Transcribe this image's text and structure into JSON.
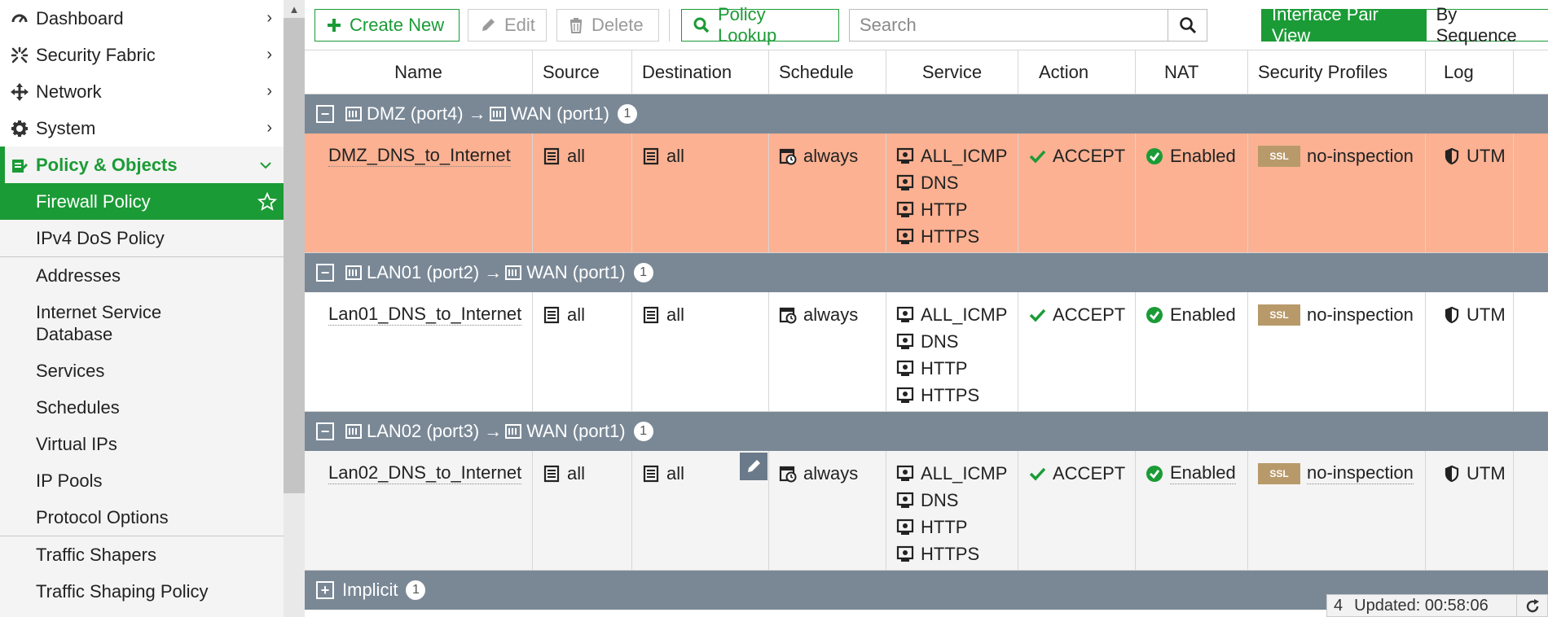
{
  "sidebar": {
    "items": [
      {
        "label": "Dashboard",
        "icon": "dashboard-icon"
      },
      {
        "label": "Security Fabric",
        "icon": "security-fabric-icon"
      },
      {
        "label": "Network",
        "icon": "network-icon"
      },
      {
        "label": "System",
        "icon": "gear-icon"
      },
      {
        "label": "Policy & Objects",
        "icon": "policy-icon"
      }
    ],
    "sub_items": [
      {
        "label": "Firewall Policy"
      },
      {
        "label": "IPv4 DoS Policy"
      },
      {
        "label": "Addresses"
      },
      {
        "label": "Internet Service Database"
      },
      {
        "label": "Services"
      },
      {
        "label": "Schedules"
      },
      {
        "label": "Virtual IPs"
      },
      {
        "label": "IP Pools"
      },
      {
        "label": "Protocol Options"
      },
      {
        "label": "Traffic Shapers"
      },
      {
        "label": "Traffic Shaping Policy"
      }
    ]
  },
  "toolbar": {
    "create_label": "Create New",
    "edit_label": "Edit",
    "delete_label": "Delete",
    "lookup_label": "Policy Lookup",
    "search_placeholder": "Search",
    "view_interface_pair": "Interface Pair View",
    "view_by_sequence": "By Sequence"
  },
  "table": {
    "columns": [
      "Name",
      "Source",
      "Destination",
      "Schedule",
      "Service",
      "Action",
      "NAT",
      "Security Profiles",
      "Log"
    ],
    "groups": [
      {
        "src_iface": "DMZ (port4)",
        "dst_iface": "WAN (port1)",
        "arrow": "→",
        "count": "1",
        "policy": {
          "name": "DMZ_DNS_to_Internet",
          "source": "all",
          "destination": "all",
          "schedule": "always",
          "services": [
            "ALL_ICMP",
            "DNS",
            "HTTP",
            "HTTPS"
          ],
          "action": "ACCEPT",
          "nat": "Enabled",
          "ssl_badge": "SSL",
          "profile": "no-inspection",
          "log": "UTM"
        }
      },
      {
        "src_iface": "LAN01 (port2)",
        "dst_iface": "WAN (port1)",
        "arrow": "→",
        "count": "1",
        "policy": {
          "name": "Lan01_DNS_to_Internet",
          "source": "all",
          "destination": "all",
          "schedule": "always",
          "services": [
            "ALL_ICMP",
            "DNS",
            "HTTP",
            "HTTPS"
          ],
          "action": "ACCEPT",
          "nat": "Enabled",
          "ssl_badge": "SSL",
          "profile": "no-inspection",
          "log": "UTM"
        }
      },
      {
        "src_iface": "LAN02 (port3)",
        "dst_iface": "WAN (port1)",
        "arrow": "→",
        "count": "1",
        "policy": {
          "name": "Lan02_DNS_to_Internet",
          "source": "all",
          "destination": "all",
          "schedule": "always",
          "services": [
            "ALL_ICMP",
            "DNS",
            "HTTP",
            "HTTPS"
          ],
          "action": "ACCEPT",
          "nat": "Enabled",
          "ssl_badge": "SSL",
          "profile": "no-inspection",
          "log": "UTM"
        }
      }
    ],
    "implicit": {
      "label": "Implicit",
      "count": "1"
    }
  },
  "status": {
    "count": "4",
    "updated": "Updated: 00:58:06"
  },
  "colors": {
    "accent": "#1b9b36",
    "group_bar": "#7a8896",
    "highlight_row": "#fbb192",
    "ssl_badge": "#b89a6a"
  }
}
